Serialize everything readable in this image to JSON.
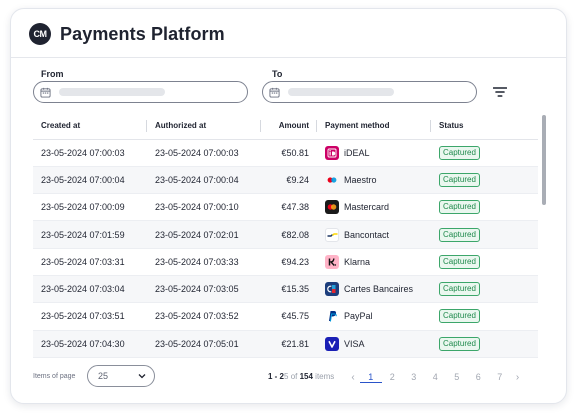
{
  "app": {
    "logo_text": "CM",
    "title": "Payments Platform"
  },
  "filters": {
    "from_label": "From",
    "to_label": "To"
  },
  "table": {
    "columns": [
      "Created at",
      "Authorized at",
      "Amount",
      "Payment method",
      "Status"
    ],
    "rows": [
      {
        "created": "23-05-2024 07:00:03",
        "authorized": "23-05-2024 07:00:03",
        "amount": "€50.81",
        "method": "iDEAL",
        "method_icon": "ideal-icon",
        "status": "Captured"
      },
      {
        "created": "23-05-2024 07:00:04",
        "authorized": "23-05-2024 07:00:04",
        "amount": "€9.24",
        "method": "Maestro",
        "method_icon": "maestro-icon",
        "status": "Captured"
      },
      {
        "created": "23-05-2024 07:00:09",
        "authorized": "23-05-2024 07:00:10",
        "amount": "€47.38",
        "method": "Mastercard",
        "method_icon": "mastercard-icon",
        "status": "Captured"
      },
      {
        "created": "23-05-2024 07:01:59",
        "authorized": "23-05-2024 07:02:01",
        "amount": "€82.08",
        "method": "Bancontact",
        "method_icon": "bancontact-icon",
        "status": "Captured"
      },
      {
        "created": "23-05-2024 07:03:31",
        "authorized": "23-05-2024 07:03:33",
        "amount": "€94.23",
        "method": "Klarna",
        "method_icon": "klarna-icon",
        "status": "Captured"
      },
      {
        "created": "23-05-2024 07:03:04",
        "authorized": "23-05-2024 07:03:05",
        "amount": "€15.35",
        "method": "Cartes Bancaires",
        "method_icon": "cartes-bancaires-icon",
        "status": "Captured"
      },
      {
        "created": "23-05-2024 07:03:51",
        "authorized": "23-05-2024 07:03:52",
        "amount": "€45.75",
        "method": "PayPal",
        "method_icon": "paypal-icon",
        "status": "Captured"
      },
      {
        "created": "23-05-2024 07:04:30",
        "authorized": "23-05-2024 07:05:01",
        "amount": "€21.81",
        "method": "VISA",
        "method_icon": "visa-icon",
        "status": "Captured"
      }
    ]
  },
  "footer": {
    "items_per_page_label": "Items of page",
    "items_per_page_value": "25",
    "range_start": "1 - 2",
    "range_mid": "5 of ",
    "range_total": "154",
    "range_suffix": " items",
    "pages": [
      "1",
      "2",
      "3",
      "4",
      "5",
      "6",
      "7"
    ],
    "active_page": "1"
  },
  "colors": {
    "accent": "#2a54c9",
    "status_captured": "#1f8a4c",
    "ideal": "#cc0066",
    "maestro_red": "#eb001b",
    "maestro_blue": "#0099df",
    "mastercard_bg": "#1a1a1a",
    "klarna": "#ffb3c7",
    "visa": "#1a1fb5",
    "paypal": "#003087"
  }
}
